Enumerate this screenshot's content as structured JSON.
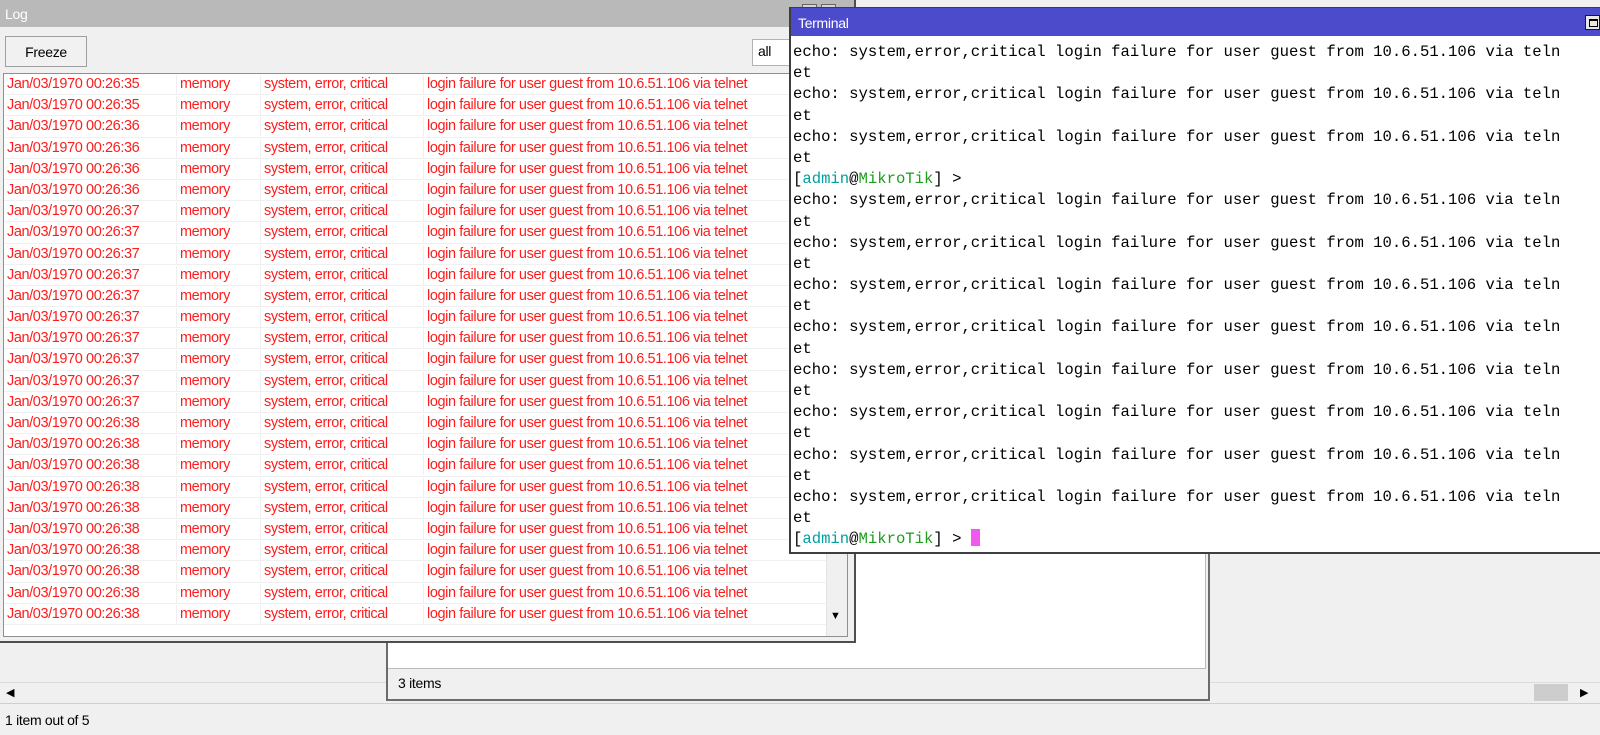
{
  "log_window": {
    "title": "Log",
    "freeze_label": "Freeze",
    "topic_filter": "all",
    "rows": [
      {
        "time": "Jan/03/1970 00:26:35",
        "buffer": "memory",
        "topics": "system, error, critical",
        "message": "login failure for user guest from 10.6.51.106 via telnet"
      },
      {
        "time": "Jan/03/1970 00:26:35",
        "buffer": "memory",
        "topics": "system, error, critical",
        "message": "login failure for user guest from 10.6.51.106 via telnet"
      },
      {
        "time": "Jan/03/1970 00:26:36",
        "buffer": "memory",
        "topics": "system, error, critical",
        "message": "login failure for user guest from 10.6.51.106 via telnet"
      },
      {
        "time": "Jan/03/1970 00:26:36",
        "buffer": "memory",
        "topics": "system, error, critical",
        "message": "login failure for user guest from 10.6.51.106 via telnet"
      },
      {
        "time": "Jan/03/1970 00:26:36",
        "buffer": "memory",
        "topics": "system, error, critical",
        "message": "login failure for user guest from 10.6.51.106 via telnet"
      },
      {
        "time": "Jan/03/1970 00:26:36",
        "buffer": "memory",
        "topics": "system, error, critical",
        "message": "login failure for user guest from 10.6.51.106 via telnet"
      },
      {
        "time": "Jan/03/1970 00:26:37",
        "buffer": "memory",
        "topics": "system, error, critical",
        "message": "login failure for user guest from 10.6.51.106 via telnet"
      },
      {
        "time": "Jan/03/1970 00:26:37",
        "buffer": "memory",
        "topics": "system, error, critical",
        "message": "login failure for user guest from 10.6.51.106 via telnet"
      },
      {
        "time": "Jan/03/1970 00:26:37",
        "buffer": "memory",
        "topics": "system, error, critical",
        "message": "login failure for user guest from 10.6.51.106 via telnet"
      },
      {
        "time": "Jan/03/1970 00:26:37",
        "buffer": "memory",
        "topics": "system, error, critical",
        "message": "login failure for user guest from 10.6.51.106 via telnet"
      },
      {
        "time": "Jan/03/1970 00:26:37",
        "buffer": "memory",
        "topics": "system, error, critical",
        "message": "login failure for user guest from 10.6.51.106 via telnet"
      },
      {
        "time": "Jan/03/1970 00:26:37",
        "buffer": "memory",
        "topics": "system, error, critical",
        "message": "login failure for user guest from 10.6.51.106 via telnet"
      },
      {
        "time": "Jan/03/1970 00:26:37",
        "buffer": "memory",
        "topics": "system, error, critical",
        "message": "login failure for user guest from 10.6.51.106 via telnet"
      },
      {
        "time": "Jan/03/1970 00:26:37",
        "buffer": "memory",
        "topics": "system, error, critical",
        "message": "login failure for user guest from 10.6.51.106 via telnet"
      },
      {
        "time": "Jan/03/1970 00:26:37",
        "buffer": "memory",
        "topics": "system, error, critical",
        "message": "login failure for user guest from 10.6.51.106 via telnet"
      },
      {
        "time": "Jan/03/1970 00:26:37",
        "buffer": "memory",
        "topics": "system, error, critical",
        "message": "login failure for user guest from 10.6.51.106 via telnet"
      },
      {
        "time": "Jan/03/1970 00:26:38",
        "buffer": "memory",
        "topics": "system, error, critical",
        "message": "login failure for user guest from 10.6.51.106 via telnet"
      },
      {
        "time": "Jan/03/1970 00:26:38",
        "buffer": "memory",
        "topics": "system, error, critical",
        "message": "login failure for user guest from 10.6.51.106 via telnet"
      },
      {
        "time": "Jan/03/1970 00:26:38",
        "buffer": "memory",
        "topics": "system, error, critical",
        "message": "login failure for user guest from 10.6.51.106 via telnet"
      },
      {
        "time": "Jan/03/1970 00:26:38",
        "buffer": "memory",
        "topics": "system, error, critical",
        "message": "login failure for user guest from 10.6.51.106 via telnet"
      },
      {
        "time": "Jan/03/1970 00:26:38",
        "buffer": "memory",
        "topics": "system, error, critical",
        "message": "login failure for user guest from 10.6.51.106 via telnet"
      },
      {
        "time": "Jan/03/1970 00:26:38",
        "buffer": "memory",
        "topics": "system, error, critical",
        "message": "login failure for user guest from 10.6.51.106 via telnet"
      },
      {
        "time": "Jan/03/1970 00:26:38",
        "buffer": "memory",
        "topics": "system, error, critical",
        "message": "login failure for user guest from 10.6.51.106 via telnet"
      },
      {
        "time": "Jan/03/1970 00:26:38",
        "buffer": "memory",
        "topics": "system, error, critical",
        "message": "login failure for user guest from 10.6.51.106 via telnet"
      },
      {
        "time": "Jan/03/1970 00:26:38",
        "buffer": "memory",
        "topics": "system, error, critical",
        "message": "login failure for user guest from 10.6.51.106 via telnet"
      },
      {
        "time": "Jan/03/1970 00:26:38",
        "buffer": "memory",
        "topics": "system, error, critical",
        "message": "login failure for user guest from 10.6.51.106 via telnet"
      }
    ],
    "row_color": "#ff1c1c"
  },
  "terminal": {
    "title": "Terminal",
    "lines": [
      {
        "type": "text",
        "text": "echo: system,error,critical login failure for user guest from 10.6.51.106 via teln"
      },
      {
        "type": "text",
        "text": "et"
      },
      {
        "type": "text",
        "text": "echo: system,error,critical login failure for user guest from 10.6.51.106 via teln"
      },
      {
        "type": "text",
        "text": "et"
      },
      {
        "type": "text",
        "text": "echo: system,error,critical login failure for user guest from 10.6.51.106 via teln"
      },
      {
        "type": "text",
        "text": "et"
      },
      {
        "type": "prompt"
      },
      {
        "type": "text",
        "text": "echo: system,error,critical login failure for user guest from 10.6.51.106 via teln"
      },
      {
        "type": "text",
        "text": "et"
      },
      {
        "type": "text",
        "text": "echo: system,error,critical login failure for user guest from 10.6.51.106 via teln"
      },
      {
        "type": "text",
        "text": "et"
      },
      {
        "type": "text",
        "text": "echo: system,error,critical login failure for user guest from 10.6.51.106 via teln"
      },
      {
        "type": "text",
        "text": "et"
      },
      {
        "type": "text",
        "text": "echo: system,error,critical login failure for user guest from 10.6.51.106 via teln"
      },
      {
        "type": "text",
        "text": "et"
      },
      {
        "type": "text",
        "text": "echo: system,error,critical login failure for user guest from 10.6.51.106 via teln"
      },
      {
        "type": "text",
        "text": "et"
      },
      {
        "type": "text",
        "text": "echo: system,error,critical login failure for user guest from 10.6.51.106 via teln"
      },
      {
        "type": "text",
        "text": "et"
      },
      {
        "type": "text",
        "text": "echo: system,error,critical login failure for user guest from 10.6.51.106 via teln"
      },
      {
        "type": "text",
        "text": "et"
      },
      {
        "type": "text",
        "text": "echo: system,error,critical login failure for user guest from 10.6.51.106 via teln"
      },
      {
        "type": "text",
        "text": "et"
      },
      {
        "type": "prompt",
        "active": true
      }
    ],
    "prompt": {
      "open": "[",
      "user": "admin",
      "at": "@",
      "host": "MikroTik",
      "close": "] >"
    },
    "title_bar_color": "#4b4bcb",
    "cursor_color": "#f058f0"
  },
  "middle_window": {
    "status": "3 items"
  },
  "background_window": {
    "status": "1 item out of 5"
  }
}
